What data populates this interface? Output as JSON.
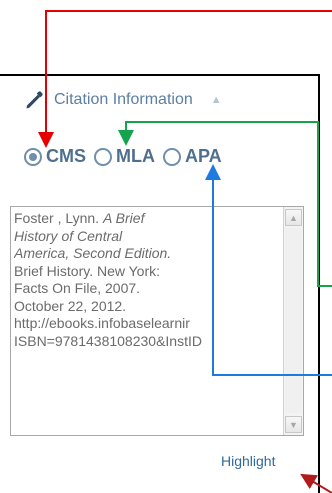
{
  "panel": {
    "title": "Citation Information",
    "collapse_icon": "triangle-up-icon",
    "pencil_icon": "pencil-icon"
  },
  "citation_styles": [
    {
      "label": "CMS",
      "selected": true
    },
    {
      "label": "MLA",
      "selected": false
    },
    {
      "label": "APA",
      "selected": false
    }
  ],
  "citation_text": {
    "line1": "Foster , Lynn. ",
    "line1_italic": "A Brief",
    "line2": "History of Central",
    "line3": "America, Second Edition.",
    "line4": "Brief History. New York:",
    "line5": "Facts On File, 2007.",
    "line6": "October 22, 2012.",
    "line7": "http://ebooks.infobaselearnir",
    "line8": "ISBN=9781438108230&InstID"
  },
  "links": {
    "highlight": "Highlight"
  },
  "colors": {
    "accent": "#5b7ea1",
    "annotation_red": "#e60000",
    "annotation_green": "#14a44d",
    "annotation_blue": "#1f7ae0",
    "annotation_darkred": "#b21b1b"
  }
}
